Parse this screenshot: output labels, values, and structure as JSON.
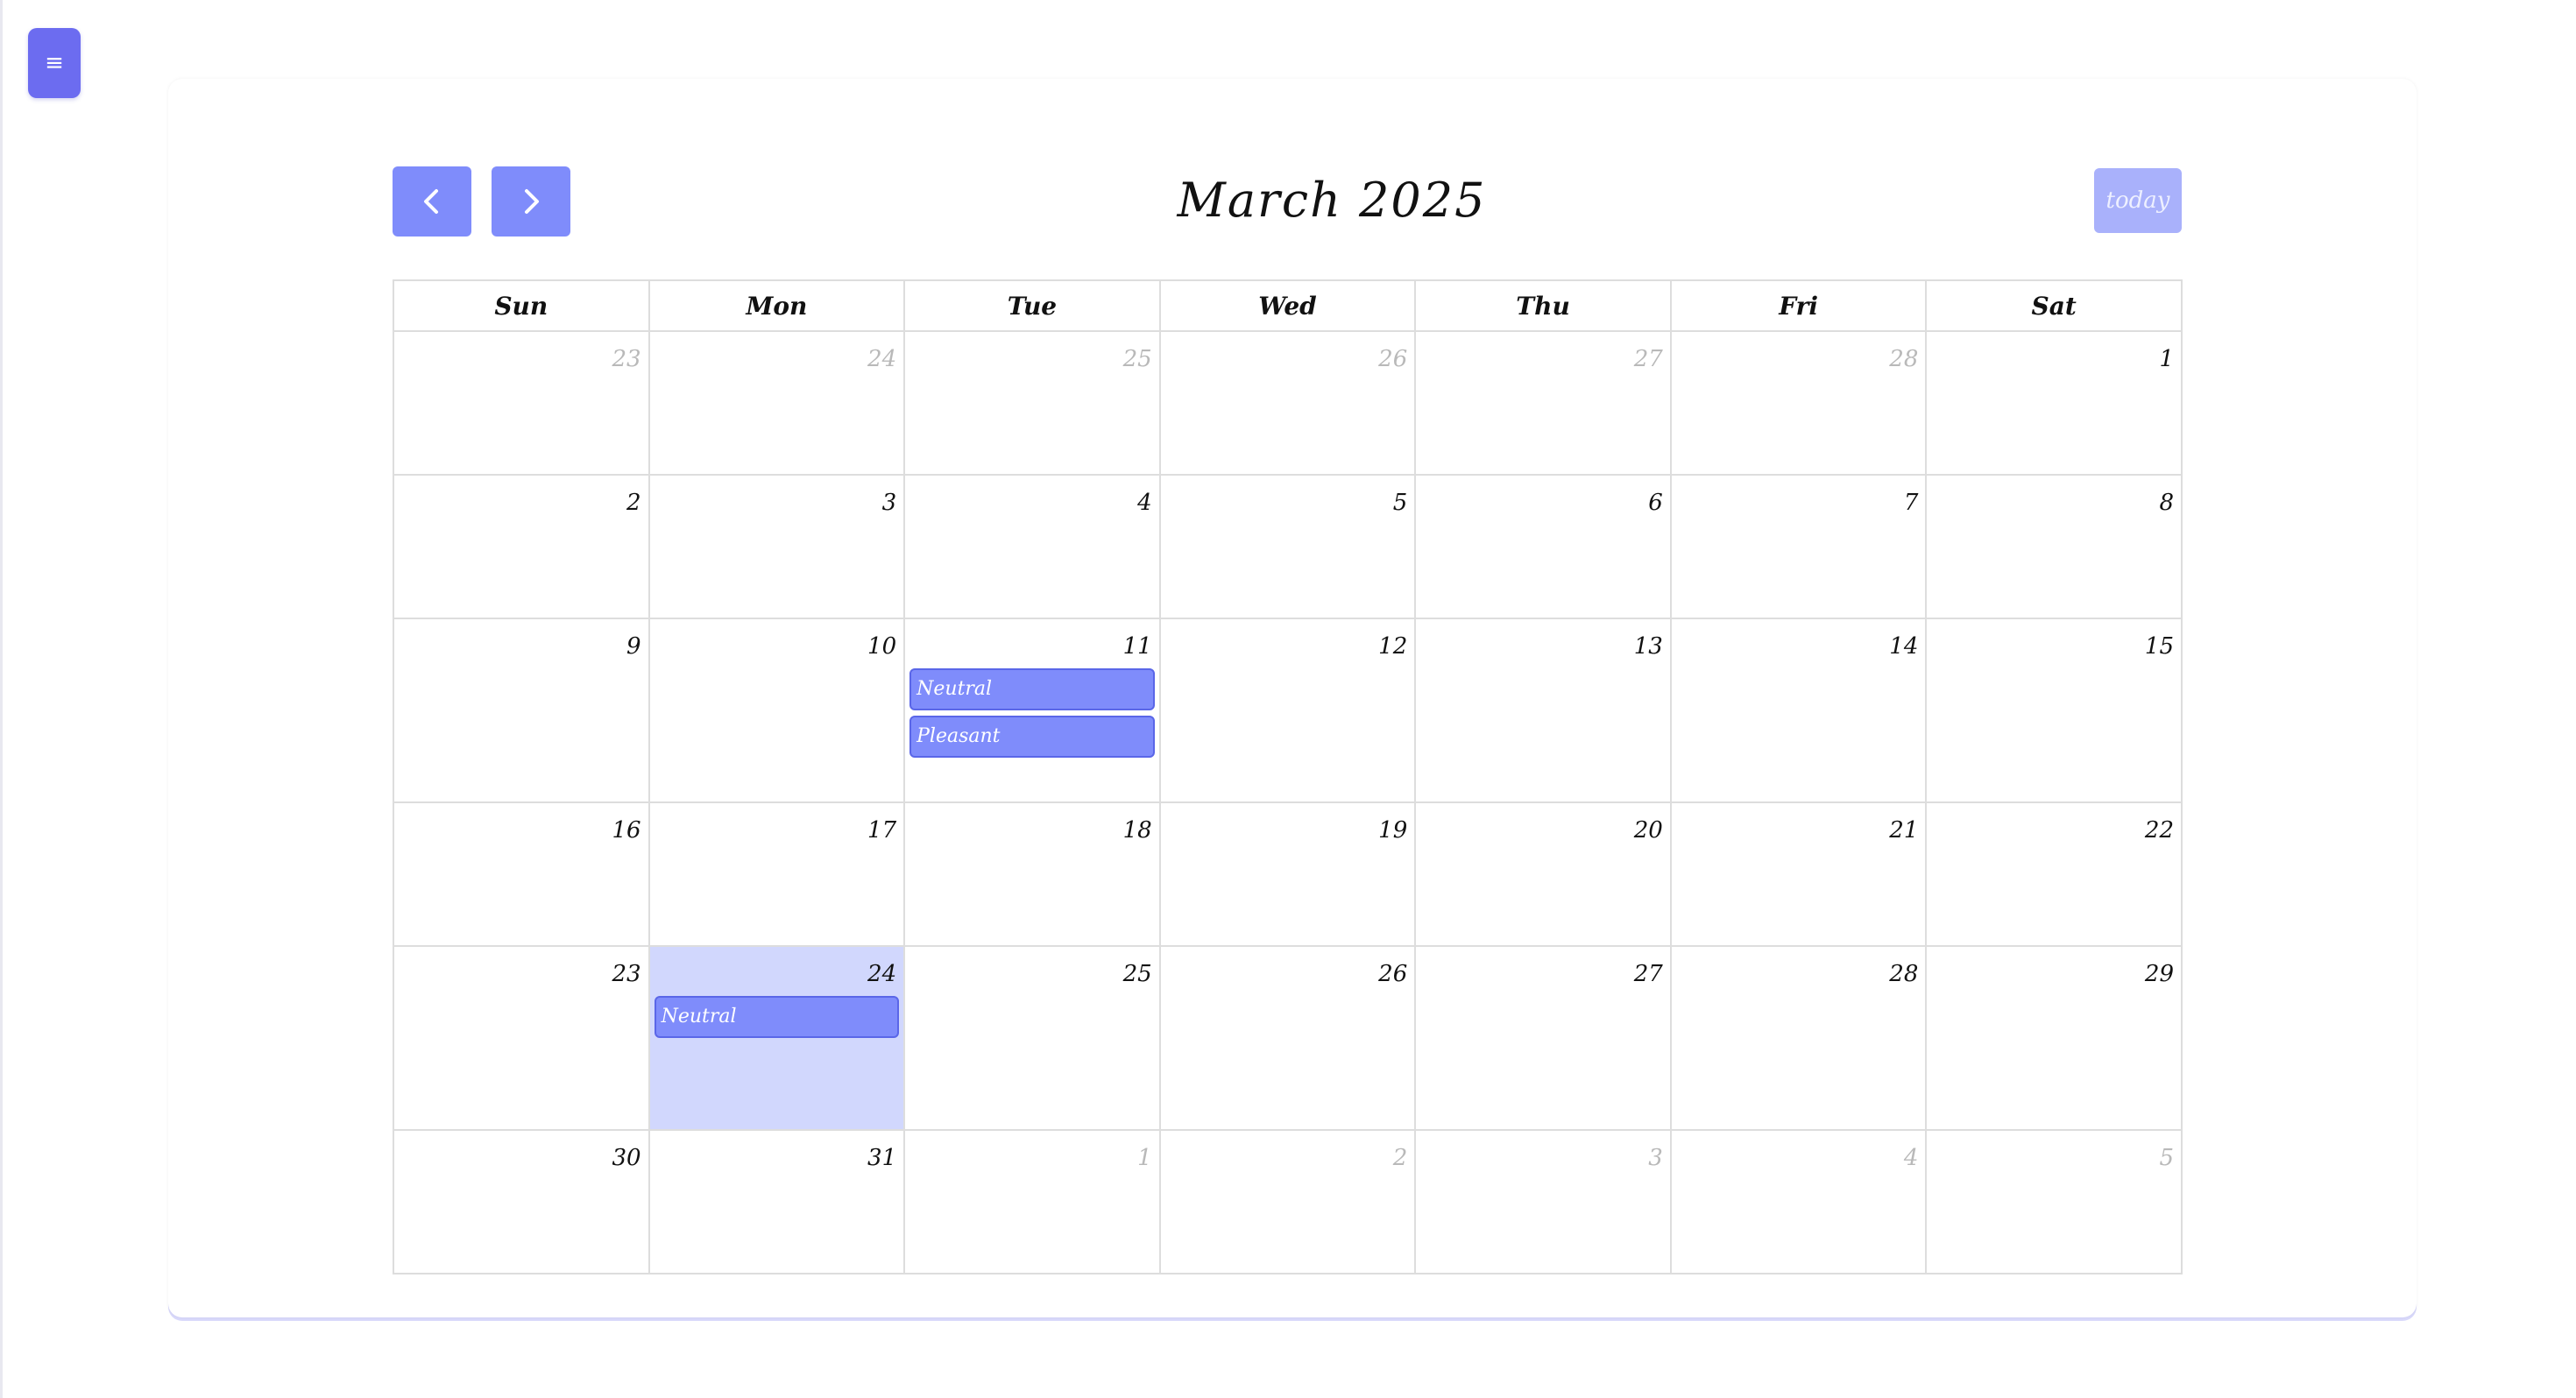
{
  "app": {
    "menu_icon": "hamburger-menu-icon",
    "accent_color": "#7f8cfb",
    "menu_color": "#6c6cf0",
    "today_highlight": "#d1d7fd"
  },
  "toolbar": {
    "prev_icon": "chevron-left-icon",
    "next_icon": "chevron-right-icon",
    "title": "March 2025",
    "today_label": "today"
  },
  "calendar": {
    "weekdays": [
      "Sun",
      "Mon",
      "Tue",
      "Wed",
      "Thu",
      "Fri",
      "Sat"
    ],
    "weeks": [
      {
        "days": [
          {
            "n": "23",
            "other": true
          },
          {
            "n": "24",
            "other": true
          },
          {
            "n": "25",
            "other": true
          },
          {
            "n": "26",
            "other": true
          },
          {
            "n": "27",
            "other": true
          },
          {
            "n": "28",
            "other": true
          },
          {
            "n": "1"
          }
        ]
      },
      {
        "days": [
          {
            "n": "2"
          },
          {
            "n": "3"
          },
          {
            "n": "4"
          },
          {
            "n": "5"
          },
          {
            "n": "6"
          },
          {
            "n": "7"
          },
          {
            "n": "8"
          }
        ]
      },
      {
        "days": [
          {
            "n": "9"
          },
          {
            "n": "10"
          },
          {
            "n": "11",
            "events": [
              "Neutral",
              "Pleasant"
            ]
          },
          {
            "n": "12"
          },
          {
            "n": "13"
          },
          {
            "n": "14"
          },
          {
            "n": "15"
          }
        ]
      },
      {
        "days": [
          {
            "n": "16"
          },
          {
            "n": "17"
          },
          {
            "n": "18"
          },
          {
            "n": "19"
          },
          {
            "n": "20"
          },
          {
            "n": "21"
          },
          {
            "n": "22"
          }
        ]
      },
      {
        "days": [
          {
            "n": "23"
          },
          {
            "n": "24",
            "today": true,
            "events": [
              "Neutral"
            ]
          },
          {
            "n": "25"
          },
          {
            "n": "26"
          },
          {
            "n": "27"
          },
          {
            "n": "28"
          },
          {
            "n": "29"
          }
        ]
      },
      {
        "days": [
          {
            "n": "30"
          },
          {
            "n": "31"
          },
          {
            "n": "1",
            "other": true
          },
          {
            "n": "2",
            "other": true
          },
          {
            "n": "3",
            "other": true
          },
          {
            "n": "4",
            "other": true
          },
          {
            "n": "5",
            "other": true
          }
        ]
      }
    ]
  }
}
